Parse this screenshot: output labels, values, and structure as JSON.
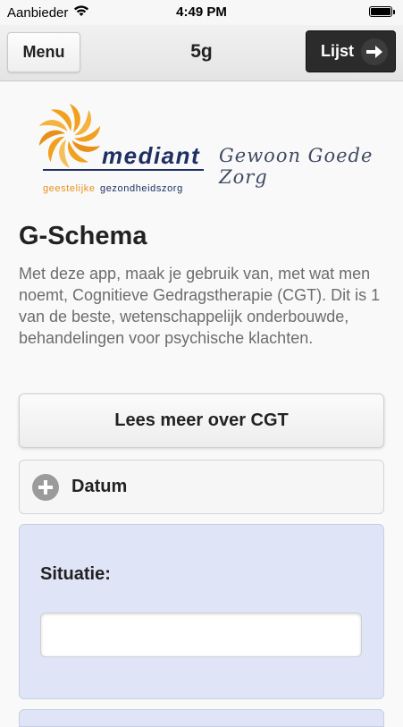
{
  "status_bar": {
    "carrier": "Aanbieder",
    "time": "4:49 PM"
  },
  "header": {
    "menu_label": "Menu",
    "title": "5g",
    "list_label": "Lijst"
  },
  "logo": {
    "brand": "mediant",
    "subtitle_a": "geestelijke",
    "subtitle_b": "gezondheidszorg",
    "tagline": "Gewoon Goede Zorg"
  },
  "main": {
    "title": "G-Schema",
    "intro": "Met deze app, maak je gebruik van, met wat men noemt, Cognitieve Gedragstherapie (CGT). Dit is 1 van de beste, wetenschappelijk onderbouwde, behandelingen voor psychische klachten.",
    "read_more_label": "Lees meer over CGT",
    "date_label": "Datum",
    "situation_label": "Situatie:",
    "situation_value": ""
  },
  "colors": {
    "brand_orange": "#f2a11f",
    "brand_navy": "#1e2f63",
    "panel_blue": "#dfe4f7"
  }
}
